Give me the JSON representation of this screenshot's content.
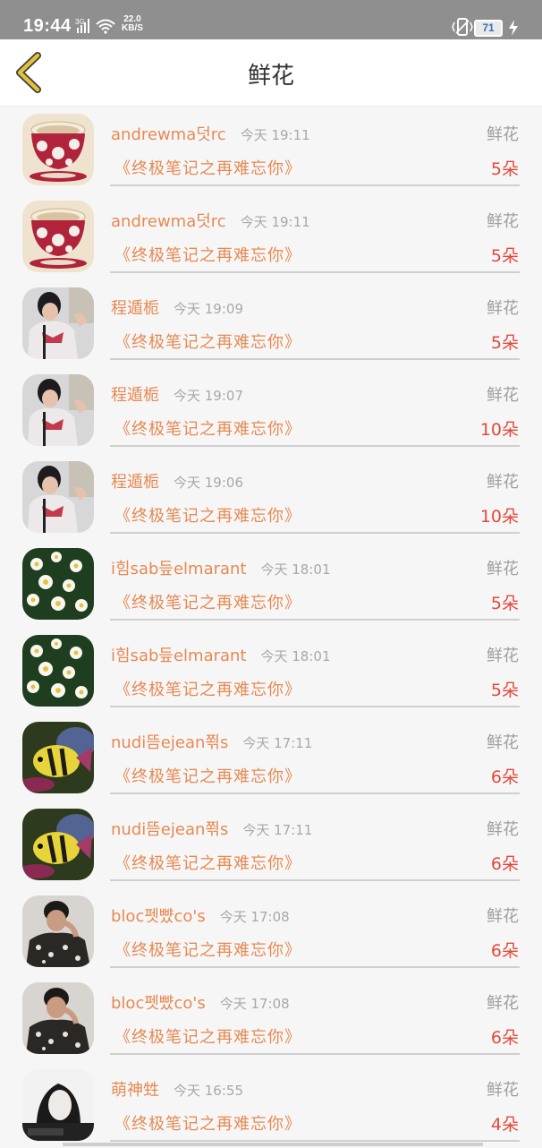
{
  "status_bar": {
    "time": "19:44",
    "net_speed_value": "22.0",
    "net_speed_unit": "KB/S",
    "battery": "71"
  },
  "header": {
    "title": "鲜花"
  },
  "gifts": [
    {
      "sender": "andrewma덧rc",
      "time": "今天 19:11",
      "type": "鲜花",
      "book": "《终极笔记之再难忘你》",
      "qty": "5朵",
      "avatar": "avatar-cup-icon"
    },
    {
      "sender": "andrewma덧rc",
      "time": "今天 19:11",
      "type": "鲜花",
      "book": "《终极笔记之再难忘你》",
      "qty": "5朵",
      "avatar": "avatar-cup-icon"
    },
    {
      "sender": "程遁栀",
      "time": "今天 19:09",
      "type": "鲜花",
      "book": "《终极笔记之再难忘你》",
      "qty": "5朵",
      "avatar": "avatar-boy-jacket-icon"
    },
    {
      "sender": "程遁栀",
      "time": "今天 19:07",
      "type": "鲜花",
      "book": "《终极笔记之再难忘你》",
      "qty": "10朵",
      "avatar": "avatar-boy-jacket-icon"
    },
    {
      "sender": "程遁栀",
      "time": "今天 19:06",
      "type": "鲜花",
      "book": "《终极笔记之再难忘你》",
      "qty": "10朵",
      "avatar": "avatar-boy-jacket-icon"
    },
    {
      "sender": "i힘sab듶elmarant",
      "time": "今天 18:01",
      "type": "鲜花",
      "book": "《终极笔记之再难忘你》",
      "qty": "5朵",
      "avatar": "avatar-daisies-icon"
    },
    {
      "sender": "i힘sab듶elmarant",
      "time": "今天 18:01",
      "type": "鲜花",
      "book": "《终极笔记之再难忘你》",
      "qty": "5朵",
      "avatar": "avatar-daisies-icon"
    },
    {
      "sender": "nudi뜸ejean쬒s",
      "time": "今天 17:11",
      "type": "鲜花",
      "book": "《终极笔记之再难忘你》",
      "qty": "6朵",
      "avatar": "avatar-fish-icon"
    },
    {
      "sender": "nudi뜸ejean쬒s",
      "time": "今天 17:11",
      "type": "鲜花",
      "book": "《终极笔记之再难忘你》",
      "qty": "6朵",
      "avatar": "avatar-fish-icon"
    },
    {
      "sender": "bloc펫뺬co's",
      "time": "今天 17:08",
      "type": "鲜花",
      "book": "《终极笔记之再难忘你》",
      "qty": "6朵",
      "avatar": "avatar-man-shirt-icon"
    },
    {
      "sender": "bloc펫뺬co's",
      "time": "今天 17:08",
      "type": "鲜花",
      "book": "《终极笔记之再难忘你》",
      "qty": "6朵",
      "avatar": "avatar-man-shirt-icon"
    },
    {
      "sender": "萌神甡",
      "time": "今天 16:55",
      "type": "鲜花",
      "book": "《终极笔记之再难忘你》",
      "qty": "4朵",
      "avatar": "avatar-girl-portrait-icon"
    }
  ],
  "colors": {
    "accent": "#e58a53",
    "quantity": "#e24a3c",
    "back_arrow": "#e0c13a"
  }
}
